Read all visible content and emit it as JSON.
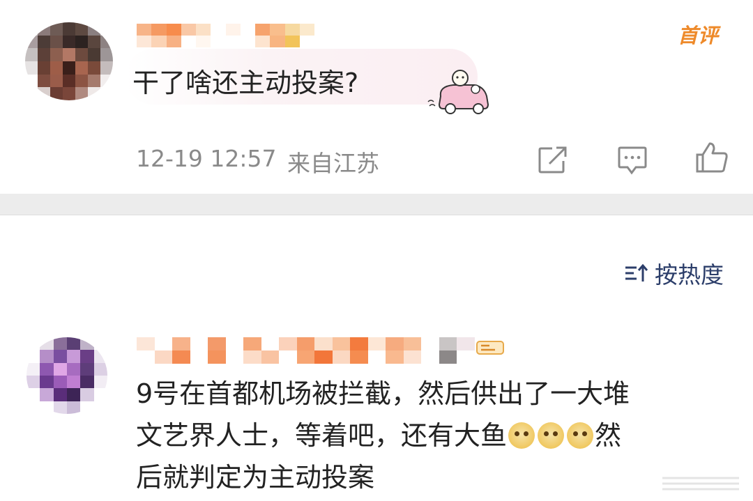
{
  "comment1": {
    "text": "干了啥还主动投案?",
    "time": "12-19 12:57",
    "location": "来自江苏",
    "badge": "首评"
  },
  "sort": {
    "label": "按热度"
  },
  "comment2": {
    "line1": "9号在首都机场被拦截，然后供出了一大堆",
    "line2_pre": "文艺界人士，等着吧，还有大鱼",
    "line2_post": "然",
    "line3": "后就判定为主动投案"
  },
  "icons": {
    "share": "share-icon",
    "comment": "comment-icon",
    "like": "like-icon",
    "sort": "sort-icon",
    "emoji": "doge-emoji-icon"
  },
  "colors": {
    "text": "#222222",
    "meta": "#8a8a8a",
    "accent": "#ee8a2a",
    "sort": "#2c3e6a",
    "divider": "#ececec"
  }
}
